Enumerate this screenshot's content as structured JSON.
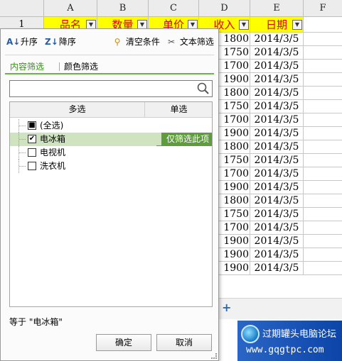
{
  "sheet": {
    "columns": [
      "A",
      "B",
      "C",
      "D",
      "E",
      "F"
    ],
    "row1_number": "1",
    "headers": [
      "品名",
      "数量",
      "单价",
      "收入",
      "日期"
    ],
    "income_values": [
      "1800",
      "1750",
      "1700",
      "1900",
      "1800",
      "1750",
      "1700",
      "1900",
      "1800",
      "1750",
      "1700",
      "1900",
      "1800",
      "1750",
      "1700",
      "1900",
      "1900",
      "1900"
    ],
    "date_values": [
      "2014/3/5",
      "2014/3/5",
      "2014/3/5",
      "2014/3/5",
      "2014/3/5",
      "2014/3/5",
      "2014/3/5",
      "2014/3/5",
      "2014/3/5",
      "2014/3/5",
      "2014/3/5",
      "2014/3/5",
      "2014/3/5",
      "2014/3/5",
      "2014/3/5",
      "2014/3/5",
      "2014/3/5",
      "2014/3/5"
    ],
    "add_sheet": "+"
  },
  "panel": {
    "sort_asc": "升序",
    "sort_desc": "降序",
    "clear": "清空条件",
    "text_filter": "文本筛选",
    "tab_content": "内容筛选",
    "tab_color": "颜色筛选",
    "search_value": "",
    "col_multi": "多选",
    "col_single": "单选",
    "items": [
      {
        "label": "(全选)",
        "mark": "■"
      },
      {
        "label": "电冰箱",
        "mark": "✔"
      },
      {
        "label": "电视机",
        "mark": ""
      },
      {
        "label": "洗衣机",
        "mark": ""
      }
    ],
    "only_this": "仅筛选此项",
    "condition": "等于 \"电冰箱\"",
    "ok": "确定",
    "cancel": "取消"
  },
  "watermark": {
    "line1": "过期罐头电脑论坛",
    "line2": "www.gqgtpc.com"
  },
  "colors": {
    "header_fill": "#ffff00",
    "header_text": "#e30000",
    "active_tab": "#3a8f1e",
    "selected_row": "#cfe3c0",
    "only_tag": "#5e9c3e"
  }
}
